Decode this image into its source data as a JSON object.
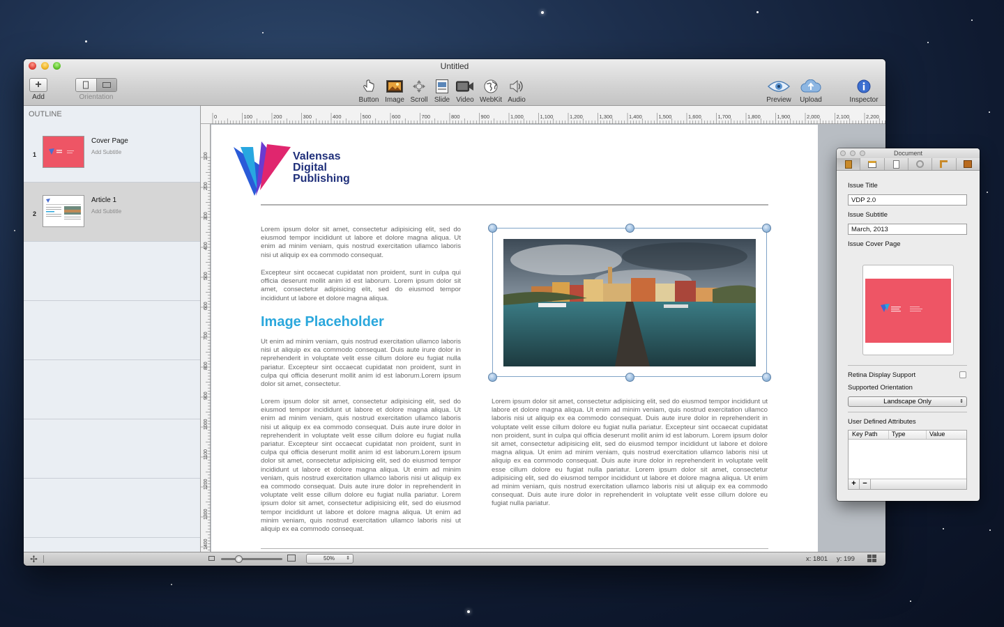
{
  "window": {
    "title": "Untitled"
  },
  "toolbar": {
    "add_label": "Add",
    "orientation_label": "Orientation",
    "tools": [
      {
        "label": "Button",
        "icon": "hand-pointer-icon"
      },
      {
        "label": "Image",
        "icon": "image-icon"
      },
      {
        "label": "Scroll",
        "icon": "scroll-icon"
      },
      {
        "label": "Slide",
        "icon": "slide-icon"
      },
      {
        "label": "Video",
        "icon": "video-camera-icon"
      },
      {
        "label": "WebKit",
        "icon": "globe-icon"
      },
      {
        "label": "Audio",
        "icon": "speaker-icon"
      }
    ],
    "preview_label": "Preview",
    "upload_label": "Upload",
    "inspector_label": "Inspector"
  },
  "sidebar": {
    "header": "OUTLINE",
    "pages": [
      {
        "num": "1",
        "title": "Cover Page",
        "subtitle": "Add Subtitle"
      },
      {
        "num": "2",
        "title": "Article 1",
        "subtitle": "Add Subtitle"
      }
    ]
  },
  "ruler": {
    "h_labels": [
      "0",
      "100",
      "200",
      "300",
      "400",
      "500",
      "600",
      "700",
      "800",
      "900",
      "1,000",
      "1,100",
      "1,200",
      "1,300",
      "1,400",
      "1,500",
      "1,600",
      "1,700",
      "1,800",
      "1,900",
      "2,000",
      "2,100",
      "2,200"
    ],
    "v_labels": [
      "100",
      "200",
      "300",
      "400",
      "500",
      "600",
      "700",
      "800",
      "900",
      "1000",
      "1100",
      "1200",
      "1300",
      "1400"
    ]
  },
  "document": {
    "logo": [
      "Valensas",
      "Digital",
      "Publishing"
    ],
    "para1": "Lorem ipsum dolor sit amet, consectetur adipisicing elit, sed do eiusmod tempor incididunt ut labore et dolore magna aliqua. Ut enim ad minim veniam, quis nostrud exercitation ullamco laboris nisi ut aliquip ex ea commodo consequat.",
    "para2": "Excepteur sint occaecat cupidatat non proident, sunt in culpa qui officia deserunt mollit anim id est laborum. Lorem ipsum dolor sit amet, consectetur adipisicing elit, sed do eiusmod tempor incididunt ut labore et dolore magna aliqua.",
    "heading": "Image Placeholder",
    "para3": "Ut enim ad minim veniam, quis nostrud exercitation ullamco laboris nisi ut aliquip ex ea commodo consequat. Duis aute irure dolor in reprehenderit in voluptate velit esse cillum dolore eu fugiat nulla pariatur. Excepteur sint occaecat cupidatat non proident, sunt in culpa qui officia deserunt mollit anim id est laborum.Lorem ipsum dolor sit amet, consectetur.",
    "para4": "Lorem ipsum dolor sit amet, consectetur adipisicing elit, sed do eiusmod tempor incididunt ut labore et dolore magna aliqua. Ut enim ad minim veniam, quis nostrud exercitation ullamco laboris nisi ut aliquip ex ea commodo consequat. Duis aute irure dolor in reprehenderit in voluptate velit esse cillum dolore eu fugiat nulla pariatur. Excepteur sint occaecat cupidatat non proident, sunt in culpa qui officia deserunt mollit anim id est laborum.Lorem ipsum dolor sit amet, consectetur adipisicing elit, sed do eiusmod tempor incididunt ut labore et dolore magna aliqua. Ut enim ad minim veniam, quis nostrud exercitation ullamco laboris nisi ut aliquip ex ea commodo consequat. Duis aute irure dolor in reprehenderit in voluptate velit esse cillum dolore eu fugiat nulla pariatur. Lorem ipsum dolor sit amet, consectetur adipisicing elit, sed do eiusmod tempor incididunt ut labore et dolore magna aliqua. Ut enim ad minim veniam, quis nostrud exercitation ullamco laboris nisi ut aliquip ex ea commodo consequat.",
    "para5": "Lorem ipsum dolor sit amet, consectetur adipisicing elit, sed do eiusmod tempor incididunt ut labore et dolore magna aliqua. Ut enim ad minim veniam, quis nostrud exercitation ullamco laboris nisi ut aliquip ex ea commodo consequat. Duis aute irure dolor in reprehenderit in voluptate velit esse cillum dolore eu fugiat nulla pariatur. Excepteur sint occaecat cupidatat non proident, sunt in culpa qui officia deserunt mollit anim id est laborum. Lorem ipsum dolor sit amet, consectetur adipisicing elit, sed do eiusmod tempor incididunt ut labore et dolore magna aliqua. Ut enim ad minim veniam, quis nostrud exercitation ullamco laboris nisi ut aliquip ex ea commodo consequat. Duis aute irure dolor in reprehenderit in voluptate velit esse cillum dolore eu fugiat nulla pariatur. Lorem ipsum dolor sit amet, consectetur adipisicing elit, sed do eiusmod tempor incididunt ut labore et dolore magna aliqua. Ut enim ad minim veniam, quis nostrud exercitation ullamco laboris nisi ut aliquip ex ea commodo consequat. Duis aute irure dolor in reprehenderit in voluptate velit esse cillum dolore eu fugiat nulla pariatur."
  },
  "bottombar": {
    "zoom": "50%",
    "x_readout": "x: 1801",
    "y_readout": "y: 199"
  },
  "inspector": {
    "title": "Document",
    "issue_title_label": "Issue Title",
    "issue_title_value": "VDP 2.0",
    "issue_subtitle_label": "Issue Subtitle",
    "issue_subtitle_value": "March, 2013",
    "cover_label": "Issue Cover Page",
    "retina_label": "Retina Display Support",
    "orientation_label": "Supported Orientation",
    "orientation_value": "Landscape Only",
    "uda_label": "User Defined Attributes",
    "columns": [
      "Key Path",
      "Type",
      "Value"
    ]
  },
  "colors": {
    "accent_blue": "#2aa7dc",
    "cover_red": "#ee5565",
    "logo_navy": "#1f2f7a"
  }
}
